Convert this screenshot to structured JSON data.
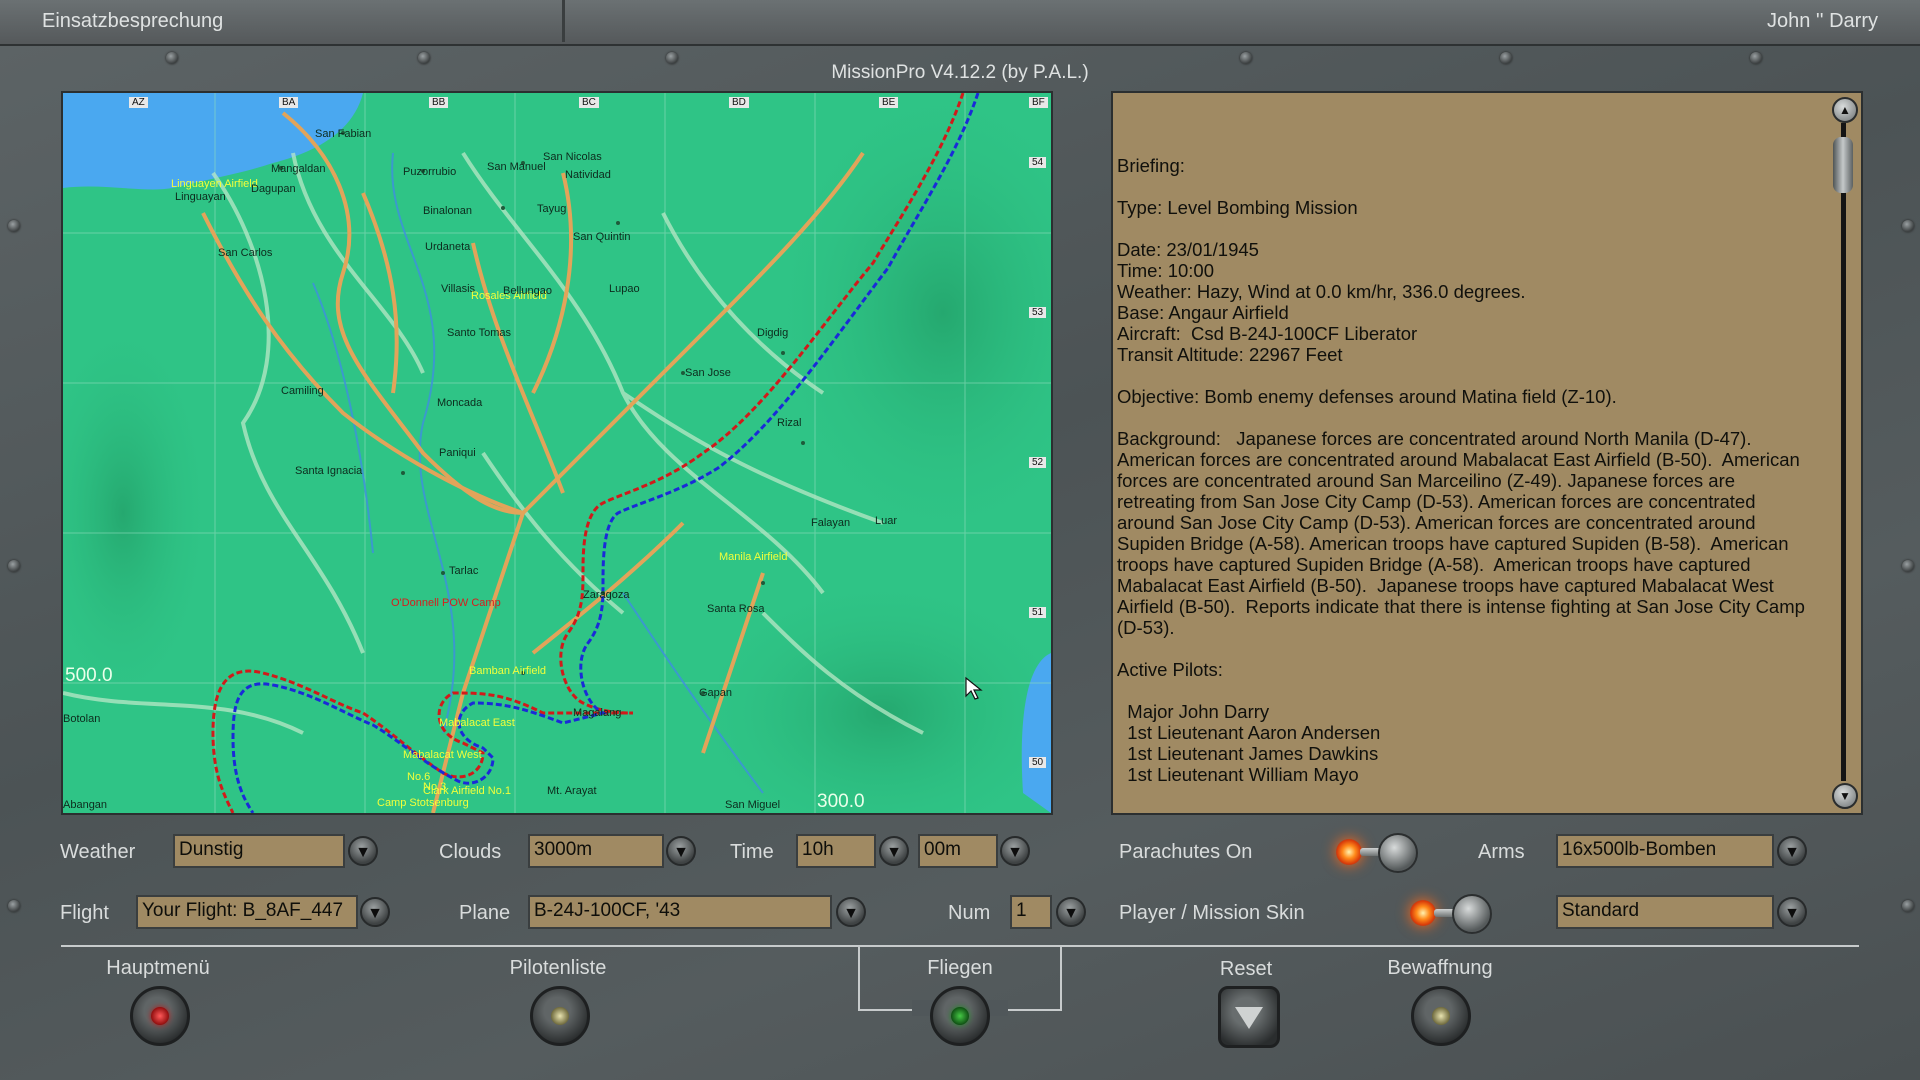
{
  "header": {
    "title": "Einsatzbesprechung",
    "user": "John '' Darry",
    "version": "MissionPro V4.12.2 (by P.A.L.)"
  },
  "map": {
    "grid_cols": [
      "AZ",
      "BA",
      "BB",
      "BC",
      "BD",
      "BE",
      "BF"
    ],
    "grid_rows": [
      "54",
      "53",
      "52",
      "51",
      "50"
    ],
    "coord_left": "500.0",
    "coord_bottom": "300.0",
    "places": [
      "San Fabian",
      "Mangaldan",
      "Linguayen Airfield",
      "Linguayan",
      "Dagupan",
      "Puzorrubio",
      "San Manuel",
      "San Nicolas",
      "Natividad",
      "Binalonan",
      "Tayug",
      "San Quintin",
      "San Carlos",
      "Urdaneta",
      "Villasis",
      "Rosales Airfield",
      "Bellungao",
      "Lupao",
      "Santo Tomas",
      "Digdig",
      "San Jose",
      "Camiling",
      "Moncada",
      "Rizal",
      "Santa Ignacia",
      "Paniqui",
      "Falayan",
      "Luar",
      "Tarlac",
      "Manila Airfield",
      "O'Donnell POW Camp",
      "Zaragoza",
      "Santa Rosa",
      "Bamban Airfield",
      "Gapan",
      "Magalang",
      "Mabalacat East",
      "Mabalacat West",
      "Botolan",
      "No.6",
      "No.3",
      "Clark Airfield No.1",
      "Mt. Arayat",
      "Camp Stotsenburg",
      "Abangan",
      "San Miguel"
    ]
  },
  "briefing": {
    "text": "Briefing:\n\nType: Level Bombing Mission\n\nDate: 23/01/1945\nTime: 10:00\nWeather: Hazy, Wind at 0.0 km/hr, 336.0 degrees.\nBase: Angaur Airfield\nAircraft:  Csd B-24J-100CF Liberator\nTransit Altitude: 22967 Feet\n\nObjective: Bomb enemy defenses around Matina field (Z-10).\n\nBackground:   Japanese forces are concentrated around North Manila (D-47).  American forces are concentrated around Mabalacat East Airfield (B-50).  American forces are concentrated around San Marceilino (Z-49). Japanese forces are retreating from San Jose City Camp (D-53). American forces are concentrated around San Jose City Camp (D-53). American forces are concentrated around Supiden Bridge (A-58). American troops have captured Supiden (B-58).  American troops have captured Supiden Bridge (A-58).  American troops have captured Mabalacat East Airfield (B-50).  Japanese troops have captured Mabalacat West Airfield (B-50).  Reports indicate that there is intense fighting at San Jose City Camp (D-53).\n\nActive Pilots:\n\n  Major John Darry\n  1st Lieutenant Aaron Andersen\n  1st Lieutenant James Dawkins\n  1st Lieutenant William Mayo"
  },
  "controls": {
    "weather_label": "Weather",
    "weather_value": "Dunstig",
    "clouds_label": "Clouds",
    "clouds_value": "3000m",
    "time_label": "Time",
    "time_hours": "10h",
    "time_minutes": "00m",
    "parachutes_label": "Parachutes On",
    "arms_label": "Arms",
    "arms_value": "16x500lb-Bomben",
    "flight_label": "Flight",
    "flight_value": "Your Flight: B_8AF_447",
    "plane_label": "Plane",
    "plane_value": "B-24J-100CF, '43",
    "num_label": "Num",
    "num_value": "1",
    "skin_label": "Player / Mission Skin",
    "skin_value": "Standard"
  },
  "buttons": {
    "main_menu": "Hauptmenü",
    "pilot_list": "Pilotenliste",
    "fly": "Fliegen",
    "reset": "Reset",
    "armament": "Bewaffnung"
  },
  "colors": {
    "map_land": "#2fc486",
    "water": "#4aa8f0",
    "route_red": "#d11a1a",
    "route_blue": "#1a2ad8",
    "panel_tan": "#a08a63"
  }
}
